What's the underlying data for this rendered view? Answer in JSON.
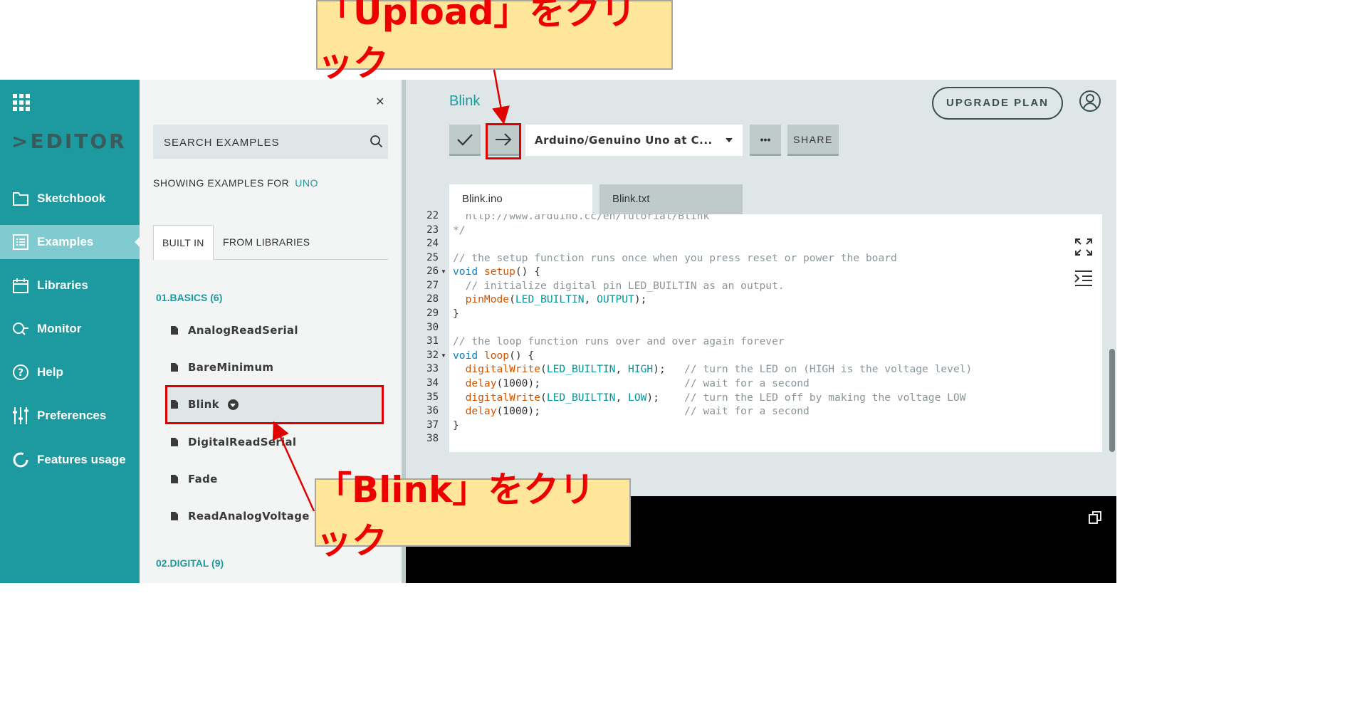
{
  "sidebar": {
    "logo": "EDITOR",
    "items": [
      {
        "label": "Sketchbook"
      },
      {
        "label": "Examples"
      },
      {
        "label": "Libraries"
      },
      {
        "label": "Monitor"
      },
      {
        "label": "Help"
      },
      {
        "label": "Preferences"
      },
      {
        "label": "Features usage"
      }
    ]
  },
  "examples_panel": {
    "close": "×",
    "search_placeholder": "SEARCH EXAMPLES",
    "showing_label": "SHOWING EXAMPLES FOR",
    "board": "UNO",
    "tabs": [
      "BUILT IN",
      "FROM LIBRARIES"
    ],
    "categories": [
      "01.BASICS (6)",
      "02.DIGITAL (9)"
    ],
    "items": [
      "AnalogReadSerial",
      "BareMinimum",
      "Blink",
      "DigitalReadSerial",
      "Fade",
      "ReadAnalogVoltage"
    ]
  },
  "editor": {
    "sketch_title": "Blink",
    "upgrade_label": "UPGRADE PLAN",
    "board_select": "Arduino/Genuino Uno at C...",
    "more_label": "•••",
    "share_label": "SHARE",
    "file_tabs": [
      "Blink.ino",
      "Blink.txt"
    ],
    "line_numbers": [
      "22",
      "23",
      "24",
      "25",
      "26",
      "27",
      "28",
      "29",
      "30",
      "31",
      "32",
      "33",
      "34",
      "35",
      "36",
      "37",
      "38"
    ]
  },
  "annotations": {
    "upload_callout": "「Upload」をクリック",
    "blink_callout": "「Blink」をクリック"
  },
  "colors": {
    "brand_teal": "#1d9aa0",
    "callout_fill": "#ffe699",
    "highlight_red": "#e00000"
  }
}
